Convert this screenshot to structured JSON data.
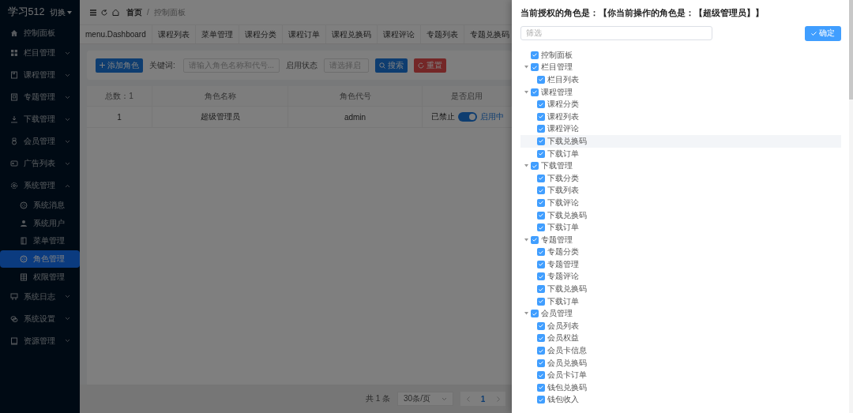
{
  "sidebar": {
    "brand": "学习512",
    "switch_label": "切换",
    "items": [
      {
        "label": "控制面板",
        "selected": false
      },
      {
        "label": "栏目管理",
        "selected": false,
        "expanded": false
      },
      {
        "label": "课程管理",
        "selected": false,
        "expanded": false
      },
      {
        "label": "专题管理",
        "selected": false,
        "expanded": false
      },
      {
        "label": "下载管理",
        "selected": false,
        "expanded": false
      },
      {
        "label": "会员管理",
        "selected": false,
        "expanded": false
      },
      {
        "label": "广告列表",
        "selected": false,
        "expanded": false
      },
      {
        "label": "系统管理",
        "selected": false,
        "expanded": true,
        "children": [
          {
            "label": "系统消息",
            "selected": false
          },
          {
            "label": "系统用户",
            "selected": false
          },
          {
            "label": "菜单管理",
            "selected": false
          },
          {
            "label": "角色管理",
            "selected": true
          },
          {
            "label": "权限管理",
            "selected": false
          }
        ]
      },
      {
        "label": "系统日志",
        "selected": false,
        "expanded": false
      },
      {
        "label": "系统设置",
        "selected": false,
        "expanded": false
      },
      {
        "label": "资源管理",
        "selected": false,
        "expanded": false
      }
    ]
  },
  "breadcrumb": {
    "items": [
      "首页",
      "控制面板"
    ],
    "separator": "/"
  },
  "tabs": [
    "menu.Dashboard",
    "课程列表",
    "菜单管理",
    "课程分类",
    "课程订单",
    "课程兑换码",
    "课程评论",
    "专题列表",
    "专题兑换码"
  ],
  "toolbar": {
    "add_button": "添加角色",
    "keyword_label": "关键词:",
    "keyword_placeholder": "请输入角色名称和代号...",
    "status_label": "启用状态",
    "status_placeholder": "请选择启",
    "search_button": "搜索",
    "reset_button": "重置"
  },
  "table": {
    "columns": [
      "总数：1",
      "角色名称",
      "角色代号",
      "是否启用"
    ],
    "rows": [
      {
        "cells": [
          "1",
          "超级管理员",
          "admin"
        ],
        "off_label": "已禁止",
        "enabled": true,
        "on_label": "启用中"
      }
    ]
  },
  "pagination": {
    "total": "共 1 条",
    "page_size": "30条/页",
    "pages": [
      {
        "label": "1",
        "selected": true
      }
    ]
  },
  "drawer": {
    "title": "当前授权的角色是：【你当前操作的角色是：【超级管理员】】",
    "filter_placeholder": "筛选",
    "confirm_button": "确定",
    "tree": [
      {
        "label": "控制面板",
        "checked": true,
        "selected": false
      },
      {
        "label": "栏目管理",
        "checked": true,
        "selected": false,
        "expanded": true,
        "children": [
          {
            "label": "栏目列表",
            "checked": true,
            "selected": false
          }
        ]
      },
      {
        "label": "课程管理",
        "checked": true,
        "selected": false,
        "expanded": true,
        "children": [
          {
            "label": "课程分类",
            "checked": true,
            "selected": false
          },
          {
            "label": "课程列表",
            "checked": true,
            "selected": false
          },
          {
            "label": "课程评论",
            "checked": true,
            "selected": false
          },
          {
            "label": "下载兑换码",
            "checked": true,
            "selected": true
          },
          {
            "label": "下载订单",
            "checked": true,
            "selected": false
          }
        ]
      },
      {
        "label": "下载管理",
        "checked": true,
        "selected": false,
        "expanded": true,
        "children": [
          {
            "label": "下载分类",
            "checked": true,
            "selected": false
          },
          {
            "label": "下载列表",
            "checked": true,
            "selected": false
          },
          {
            "label": "下载评论",
            "checked": true,
            "selected": false
          },
          {
            "label": "下载兑换码",
            "checked": true,
            "selected": false
          },
          {
            "label": "下载订单",
            "checked": true,
            "selected": false
          }
        ]
      },
      {
        "label": "专题管理",
        "checked": true,
        "selected": false,
        "expanded": true,
        "children": [
          {
            "label": "专题分类",
            "checked": true,
            "selected": false
          },
          {
            "label": "专题管理",
            "checked": true,
            "selected": false
          },
          {
            "label": "专题评论",
            "checked": true,
            "selected": false
          },
          {
            "label": "下载兑换码",
            "checked": true,
            "selected": false
          },
          {
            "label": "下载订单",
            "checked": true,
            "selected": false
          }
        ]
      },
      {
        "label": "会员管理",
        "checked": true,
        "selected": false,
        "expanded": true,
        "children": [
          {
            "label": "会员列表",
            "checked": true,
            "selected": false
          },
          {
            "label": "会员权益",
            "checked": true,
            "selected": false
          },
          {
            "label": "会员卡信息",
            "checked": true,
            "selected": false
          },
          {
            "label": "会员兑换码",
            "checked": true,
            "selected": false
          },
          {
            "label": "会员卡订单",
            "checked": true,
            "selected": false
          },
          {
            "label": "钱包兑换码",
            "checked": true,
            "selected": false
          },
          {
            "label": "钱包收入",
            "checked": true,
            "selected": false
          }
        ]
      }
    ]
  }
}
